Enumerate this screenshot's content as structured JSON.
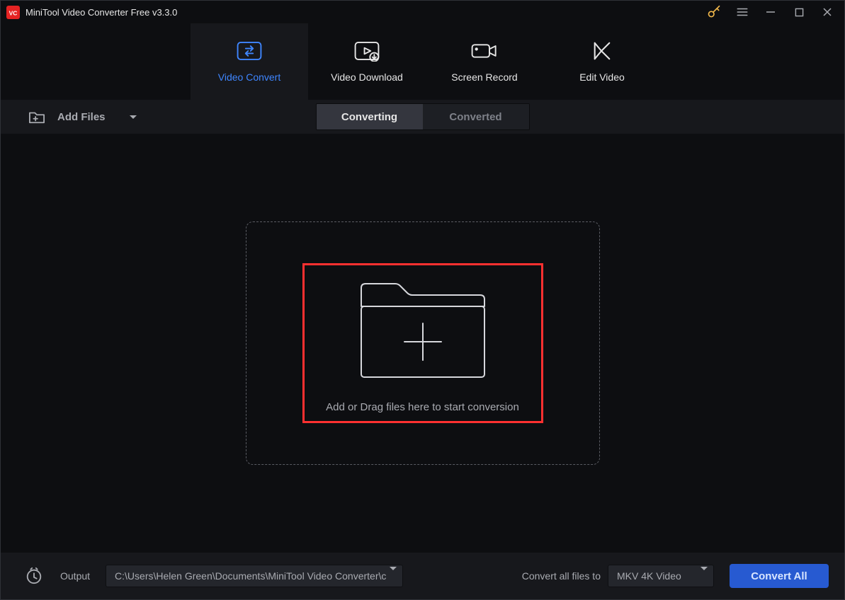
{
  "app": {
    "title": "MiniTool Video Converter Free v3.3.0",
    "logo_letters": "VC",
    "accent_color": "#3f86ff",
    "highlight_color": "#ff3030"
  },
  "window_controls": {
    "key_icon": "key-icon",
    "menu_icon": "hamburger-icon",
    "minimize_icon": "minimize-icon",
    "maximize_icon": "maximize-icon",
    "close_icon": "close-icon"
  },
  "main_nav": {
    "tabs": [
      {
        "id": "video-convert",
        "label": "Video Convert",
        "icon": "arrows-cycle-icon",
        "active": true
      },
      {
        "id": "video-download",
        "label": "Video Download",
        "icon": "download-video-icon",
        "active": false
      },
      {
        "id": "screen-record",
        "label": "Screen Record",
        "icon": "camera-icon",
        "active": false
      },
      {
        "id": "edit-video",
        "label": "Edit Video",
        "icon": "edit-movie-icon",
        "active": false
      }
    ]
  },
  "tool_row": {
    "add_files_label": "Add Files",
    "sub_tabs": [
      {
        "id": "converting",
        "label": "Converting",
        "active": true
      },
      {
        "id": "converted",
        "label": "Converted",
        "active": false
      }
    ]
  },
  "dropzone": {
    "text": "Add or Drag files here to start conversion"
  },
  "bottom_bar": {
    "output_label": "Output",
    "output_path": "C:\\Users\\Helen Green\\Documents\\MiniTool Video Converter\\c",
    "convert_to_label": "Convert all files to",
    "format_selected": "MKV 4K Video",
    "convert_all_label": "Convert All"
  }
}
